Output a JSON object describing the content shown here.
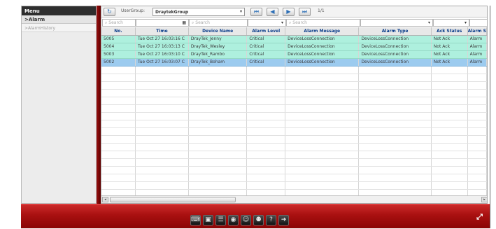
{
  "sidebar": {
    "title": "Menu",
    "items": [
      {
        "label": ">Alarm"
      },
      {
        "label": ">AlarmHistory"
      }
    ]
  },
  "toolbar": {
    "usergroup_label": "UserGroup:",
    "usergroup_value": "DraytekGroup",
    "page_indicator": "1/1"
  },
  "filters": {
    "placeholder": "Search"
  },
  "table": {
    "columns": [
      "No.",
      "Time",
      "Device Name",
      "Alarm Level",
      "Alarm Message",
      "Alarm Type",
      "Ack Status",
      "Alarm S"
    ],
    "rows": [
      [
        "5005",
        "Tue Oct 27 16:03:16 C",
        "DrayTek_Jenny",
        "Critical",
        "DeviceLossConnection",
        "DeviceLossConnection",
        "Not Ack",
        "Alarm"
      ],
      [
        "5004",
        "Tue Oct 27 16:03:13 C",
        "DrayTek_Wesley",
        "Critical",
        "DeviceLossConnection",
        "DeviceLossConnection",
        "Not Ack",
        "Alarm"
      ],
      [
        "5003",
        "Tue Oct 27 16:03:10 C",
        "DrayTek_Rambo",
        "Critical",
        "DeviceLossConnection",
        "DeviceLossConnection",
        "Not Ack",
        "Alarm"
      ],
      [
        "5002",
        "Tue Oct 27 16:03:07 C",
        "DrayTek_Boham",
        "Critical",
        "DeviceLossConnection",
        "DeviceLossConnection",
        "Not Ack",
        "Alarm"
      ]
    ]
  },
  "bottom_bar": {
    "icons": [
      "keyboard-icon",
      "monitor-icon",
      "list-icon",
      "camera-icon",
      "user-icon",
      "group-icon",
      "help-icon",
      "logout-icon"
    ]
  },
  "colors": {
    "accent_red": "#b01515",
    "row_highlight": "#aef0de",
    "row_selected": "#9ccbef",
    "header_text": "#0a3d8a"
  }
}
